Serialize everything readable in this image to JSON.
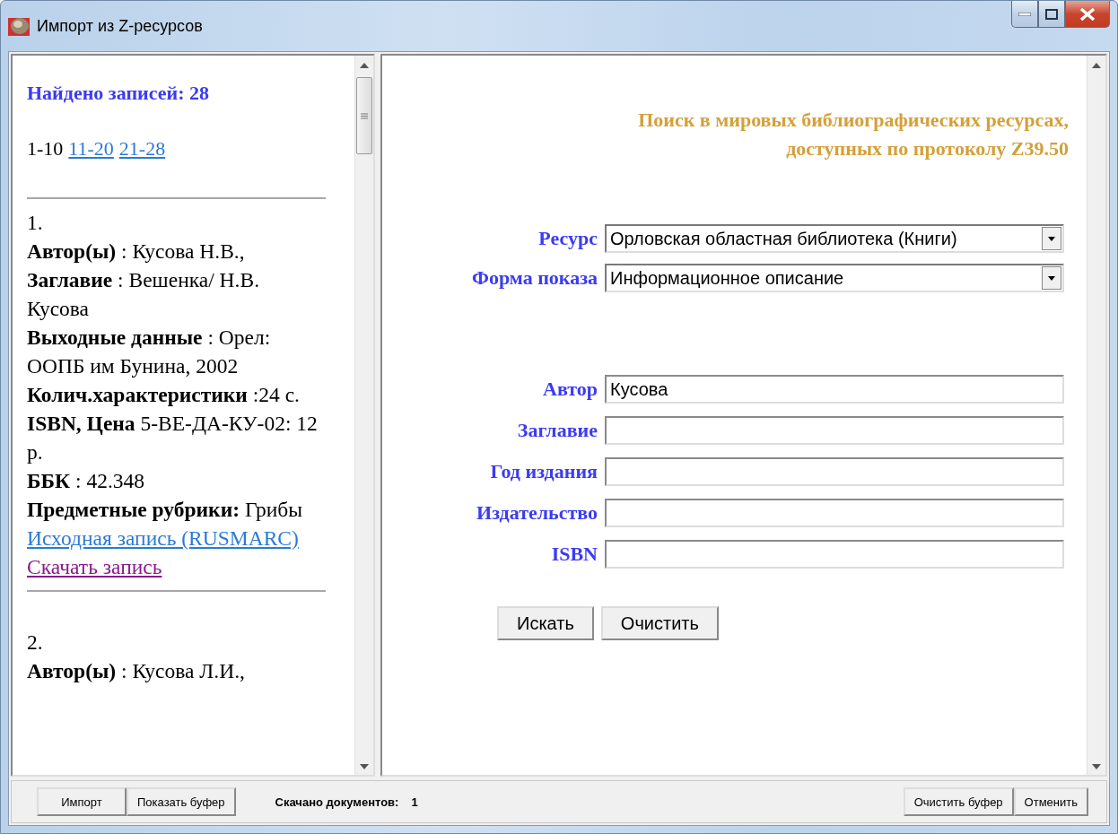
{
  "window": {
    "title": "Импорт из Z-ресурсов"
  },
  "results": {
    "heading": "Найдено записей: 28",
    "pages": [
      {
        "label": "1-10",
        "selected": true
      },
      {
        "label": "11-20",
        "selected": false
      },
      {
        "label": "21-28",
        "selected": false
      }
    ],
    "records": [
      {
        "number": "1.",
        "fields": [
          "**Автор(ы)** : Кусова Н.В.,",
          "**Заглавие** : Вешенка/ Н.В. Кусова",
          "**Выходные данные** : Орел: ООПБ им Бунина, 2002",
          "**Колич.характеристики** :24 с.",
          "**ISBN, Цена** 5-ВЕ-ДА-КУ-02: 12 р.",
          "**ББК** : 42.348",
          "**Предметные рубрики:** Грибы"
        ],
        "links": [
          {
            "label": "Исходная запись (RUSMARC)",
            "visited": false
          },
          {
            "label": "Скачать запись",
            "visited": true
          }
        ]
      },
      {
        "number": "2.",
        "fields": [
          "**Автор(ы)** : Кусова Л.И.,"
        ]
      }
    ]
  },
  "search": {
    "title": "Поиск в мировых библиографических ресурсах, доступных по протоколу Z39.50",
    "selects": [
      {
        "label": "Ресурс",
        "value": "Орловская областная библиотека (Книги)"
      },
      {
        "label": "Форма показа",
        "value": "Информационное описание"
      }
    ],
    "fields": [
      {
        "label": "Автор",
        "value": "Кусова"
      },
      {
        "label": "Заглавие"
      },
      {
        "label": "Год издания"
      },
      {
        "label": "Издательство"
      },
      {
        "label": "ISBN"
      }
    ],
    "buttons": [
      "Искать",
      "Очистить"
    ]
  },
  "bottom_bar": {
    "left_buttons": [
      "Импорт",
      "Показать буфер"
    ],
    "status_label": "Скачано документов:",
    "status_value": "1",
    "right_buttons": [
      "Очистить буфер",
      "Отменить"
    ]
  }
}
